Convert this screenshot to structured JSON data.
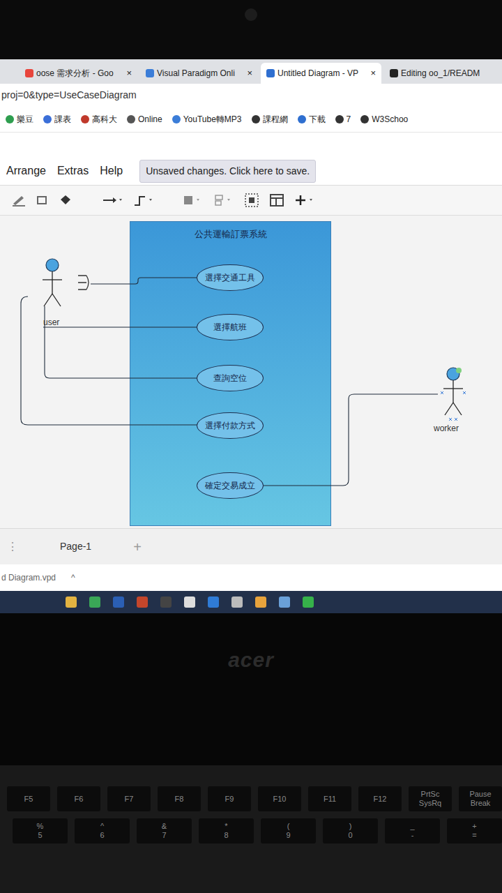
{
  "browser": {
    "close_glyph": "×",
    "tabs": [
      {
        "label": "oose 需求分析 - Goo",
        "selected": false,
        "closable": true,
        "color": "#e8453c"
      },
      {
        "label": "Visual Paradigm Onli",
        "selected": false,
        "closable": true,
        "color": "#3b7dd8"
      },
      {
        "label": "Untitled Diagram - VP",
        "selected": true,
        "closable": true,
        "color": "#2f6fd0"
      },
      {
        "label": "Editing oo_1/READM",
        "selected": false,
        "closable": false,
        "color": "#222222"
      }
    ],
    "address": "proj=0&type=UseCaseDiagram",
    "bookmarks": [
      {
        "label": "樂豆",
        "color": "#2e9e4f"
      },
      {
        "label": "課表",
        "color": "#3b6fd8"
      },
      {
        "label": "高科大",
        "color": "#c0392b"
      },
      {
        "label": "Online",
        "color": "#555555"
      },
      {
        "label": "YouTube轉MP3",
        "color": "#3b7dd8"
      },
      {
        "label": "課程網",
        "color": "#333333"
      },
      {
        "label": "下載",
        "color": "#2f6fd0"
      },
      {
        "label": "7",
        "color": "#333333"
      },
      {
        "label": "W3Schoo",
        "color": "#333333"
      }
    ]
  },
  "app": {
    "menu": [
      "Arrange",
      "Extras",
      "Help"
    ],
    "save_notice": "Unsaved changes. Click here to save."
  },
  "diagram": {
    "system": {
      "title": "公共運輸訂票系統"
    },
    "use_cases": [
      {
        "label": "選擇交通工具"
      },
      {
        "label": "選擇航班"
      },
      {
        "label": "查詢空位"
      },
      {
        "label": "選擇付款方式"
      },
      {
        "label": "確定交易成立"
      }
    ],
    "actors": [
      {
        "name": "user",
        "selected": false
      },
      {
        "name": "worker",
        "selected": true
      }
    ]
  },
  "footer": {
    "pages": [
      {
        "label": "Page-1",
        "selected": true
      }
    ],
    "add_page": "+",
    "more": "⋮"
  },
  "downloads": {
    "file": "d Diagram.vpd",
    "expand": "^"
  },
  "laptop": {
    "brand": "acer",
    "f_keys": [
      {
        "lines": [
          "F5"
        ]
      },
      {
        "lines": [
          "F6"
        ]
      },
      {
        "lines": [
          "F7"
        ]
      },
      {
        "lines": [
          "F8"
        ]
      },
      {
        "lines": [
          "F9"
        ]
      },
      {
        "lines": [
          "F10"
        ]
      },
      {
        "lines": [
          "F11"
        ]
      },
      {
        "lines": [
          "F12"
        ]
      },
      {
        "lines": [
          "PrtSc",
          "SysRq"
        ]
      },
      {
        "lines": [
          "Pause",
          "Break"
        ]
      }
    ],
    "number_keys": [
      {
        "lines": [
          "%",
          "5"
        ]
      },
      {
        "lines": [
          "^",
          "6"
        ]
      },
      {
        "lines": [
          "&",
          "7"
        ]
      },
      {
        "lines": [
          "*",
          "8"
        ]
      },
      {
        "lines": [
          "(",
          "9"
        ]
      },
      {
        "lines": [
          ")",
          "0"
        ]
      },
      {
        "lines": [
          "_",
          "-"
        ]
      },
      {
        "lines": [
          "+",
          "="
        ]
      }
    ]
  }
}
